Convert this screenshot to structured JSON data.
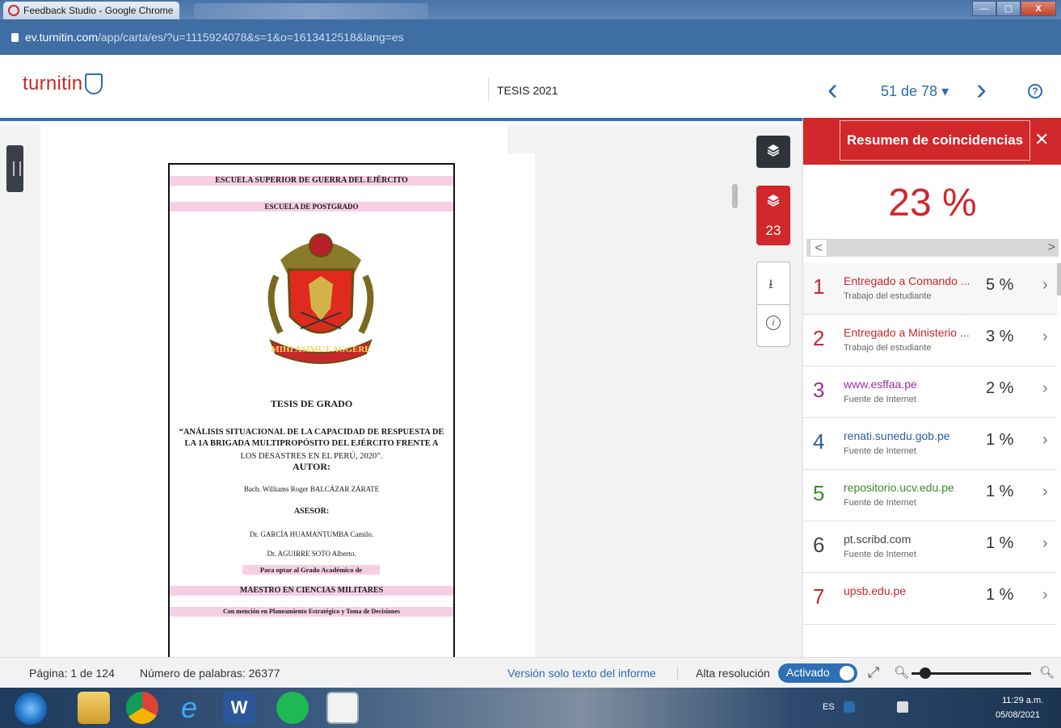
{
  "browser": {
    "tab_title": "Feedback Studio - Google Chrome",
    "url_host": "ev.turnitin.com",
    "url_path": "/app/carta/es/?u=1115924078&s=1&o=1613412518&lang=es"
  },
  "header": {
    "logo_text": "turnitin",
    "doc_title": "TESIS 2021",
    "page_indicator": "51 de 78 ▾",
    "help_label": "?"
  },
  "document": {
    "lines": {
      "l1": "ESCUELA SUPERIOR DE GUERRA DEL EJÉRCITO",
      "l2": "ESCUELA DE POSTGRADO",
      "l3": "TESIS DE GRADO",
      "l4": "“ANÁLISIS SITUACIONAL DE LA CAPACIDAD DE RESPUESTA DE",
      "l5": "LA 1A BRIGADA MULTIPROPÓSITO DEL EJÉRCITO FRENTE A",
      "l6": "LOS DESASTRES EN EL PERÚ, 2020”.",
      "l7": "AUTOR:",
      "l8": "Bach. Williams Roger BALCÁZAR ZÁRATE",
      "l9": "ASESOR:",
      "l10": "Dr. GARCÍA HUAMANTUMBA Camilo.",
      "l11": "Dr. AGUIRRE SOTO Alberto.",
      "l12": "Para optar al Grado Académico de",
      "l13": "MAESTRO EN CIENCIAS MILITARES",
      "l14": "Con mención en Planeamiento Estratégico y Toma de Decisiones"
    },
    "crest_motto": "MIHI ASIMUT AGGERE"
  },
  "toolstrip": {
    "match_count": "23",
    "download_icon": "download-icon",
    "info_icon": "info-icon"
  },
  "panel": {
    "title": "Resumen de coincidencias",
    "close_label": "✕",
    "overall_pct": "23 %",
    "prev_label": "<",
    "next_label": ">",
    "matches": [
      {
        "num": "1",
        "source": "Entregado a Comando ...",
        "type": "Trabajo del estudiante",
        "pct": "5 %",
        "color": "#c8282a"
      },
      {
        "num": "2",
        "source": "Entregado a Ministerio ...",
        "type": "Trabajo del estudiante",
        "pct": "3 %",
        "color": "#c8282a"
      },
      {
        "num": "3",
        "source": "www.esffaa.pe",
        "type": "Fuente de Internet",
        "pct": "2 %",
        "color": "#9b2fa0"
      },
      {
        "num": "4",
        "source": "renati.sunedu.gob.pe",
        "type": "Fuente de Internet",
        "pct": "1 %",
        "color": "#2a5f9e"
      },
      {
        "num": "5",
        "source": "repositorio.ucv.edu.pe",
        "type": "Fuente de Internet",
        "pct": "1 %",
        "color": "#3b8a2a"
      },
      {
        "num": "6",
        "source": "pt.scribd.com",
        "type": "Fuente de Internet",
        "pct": "1 %",
        "color": "#444444"
      },
      {
        "num": "7",
        "source": "upsb.edu.pe",
        "type": "",
        "pct": "1 %",
        "color": "#c8282a"
      }
    ]
  },
  "status": {
    "page": "Página: 1 de 124",
    "words": "Número de palabras: 26377",
    "text_only_link": "Versión solo texto del informe",
    "hires_label": "Alta resolución",
    "toggle_label": "Activado"
  },
  "taskbar": {
    "lang": "ES",
    "time": "11:29 a.m.",
    "date": "05/08/2021"
  }
}
